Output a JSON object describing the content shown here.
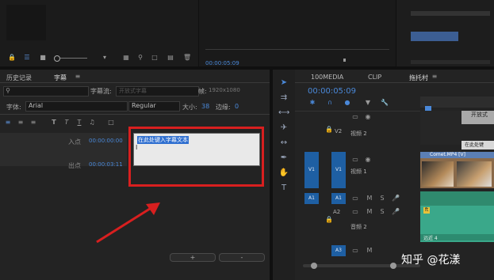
{
  "top": {
    "timecode_mid": "00:00:05:09"
  },
  "caption_panel": {
    "tab_history": "历史记录",
    "tab_captions": "字幕",
    "caption_stream_label": "字幕流:",
    "caption_stream_value": "开放式字幕",
    "frame_label": "帧:",
    "frame_value": "1920x1080",
    "font_label": "字体:",
    "font_value": "Arial",
    "style_value": "Regular",
    "size_label": "大小:",
    "size_value": "38",
    "border_label": "边缘:",
    "border_value": "0",
    "in_label": "入点",
    "in_value": "00:00:00:00",
    "out_label": "出点",
    "out_value": "00:00:03:11",
    "caption_text": "在此处键入字幕文本",
    "add_btn": "+",
    "remove_btn": "-"
  },
  "timeline": {
    "tab_media": "100MEDIA",
    "tab_clip": "CLIP",
    "tab_sequence": "拖托村",
    "timecode": "00:00:05:09",
    "tracks": [
      {
        "id": "V2",
        "name": "视频 2"
      },
      {
        "id": "V1",
        "name": "视频 1",
        "source": "V1"
      },
      {
        "id": "A1",
        "name": "",
        "source": "A1"
      },
      {
        "id": "A2",
        "name": "音频 2"
      },
      {
        "id": "A3",
        "name": "",
        "source": "A3"
      }
    ],
    "clip_open_caption": "开放式",
    "clip_caption2": "在此处键",
    "clip_video": "Comet.MP4 [V]",
    "clip_audio_tag": "ft",
    "clip_audio2": "远近 4"
  },
  "watermark": "知乎 @花漾",
  "colors": {
    "accent_blue": "#4a88d8",
    "highlight_red": "#d81f1f",
    "selection_blue": "#2f6fd0"
  }
}
